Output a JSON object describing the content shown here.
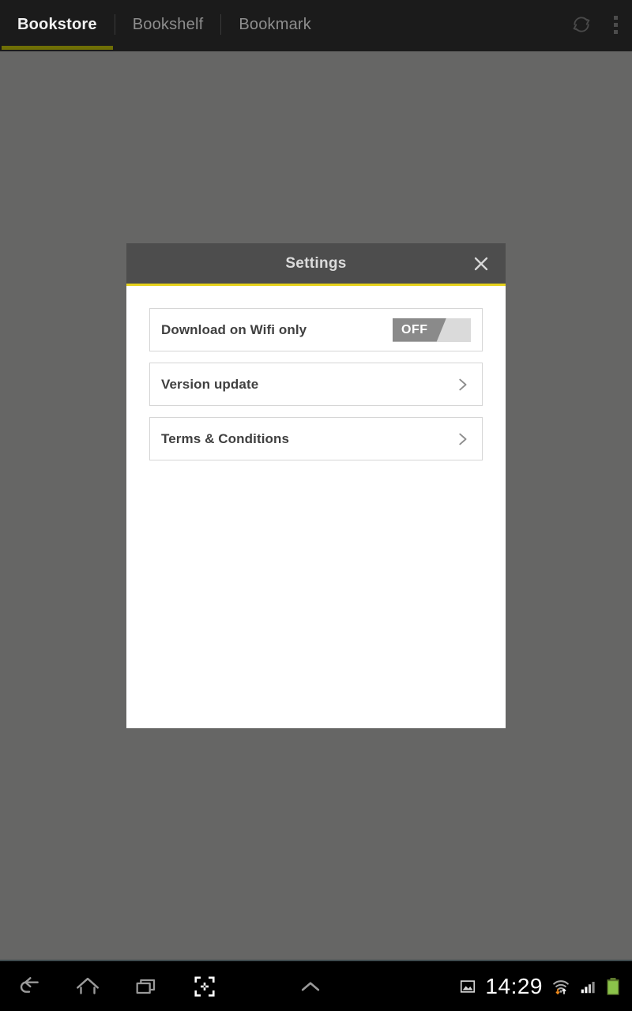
{
  "topbar": {
    "tabs": [
      {
        "label": "Bookstore",
        "active": true
      },
      {
        "label": "Bookshelf",
        "active": false
      },
      {
        "label": "Bookmark",
        "active": false
      }
    ],
    "refresh_icon": "refresh-sync-icon",
    "overflow_icon": "overflow-menu-icon",
    "accent_color": "#6f6f06",
    "background_color": "#1b1b1b"
  },
  "scrim": {
    "color": "#666665"
  },
  "dialog": {
    "title": "Settings",
    "close_icon": "close-icon",
    "header_color": "#4d4d4d",
    "accent_color": "#e6d21c",
    "rows": [
      {
        "label": "Download on Wifi only",
        "control": "toggle",
        "toggle_value": "OFF",
        "toggle_on": false
      },
      {
        "label": "Version update",
        "control": "chevron",
        "chevron_icon": "chevron-right-icon"
      },
      {
        "label": "Terms & Conditions",
        "control": "chevron",
        "chevron_icon": "chevron-right-icon"
      }
    ]
  },
  "navbar": {
    "buttons": [
      {
        "name": "back",
        "icon": "back-arrow-icon"
      },
      {
        "name": "home",
        "icon": "home-icon"
      },
      {
        "name": "recents",
        "icon": "recent-apps-icon"
      },
      {
        "name": "screenshot",
        "icon": "screenshot-capture-icon"
      },
      {
        "name": "expand",
        "icon": "chevron-up-icon"
      }
    ],
    "status": {
      "screenshot_icon": "image-notification-icon",
      "time": "14:29",
      "wifi_icon": "wifi-signal-icon",
      "cellular_icon": "cellular-signal-icon",
      "battery_icon": "battery-icon",
      "battery_color": "#8bc34a"
    }
  }
}
